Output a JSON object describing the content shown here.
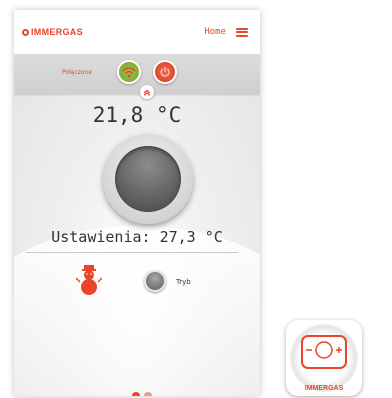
{
  "header": {
    "brand": "IMMERGAS",
    "home_label": "Home"
  },
  "status": {
    "connection_label": "Połączone"
  },
  "thermostat": {
    "current_temp": "21,8 °C",
    "settings_label": "Ustawienia: 27,3 °C",
    "mode_label": "Tryb"
  },
  "pager": {
    "current_page": 1,
    "total_pages": 2
  },
  "app_icon": {
    "brand": "IMMERGAS"
  },
  "colors": {
    "accent": "#e8452b",
    "wifi_green": "#8ab83e",
    "power_red": "#e3523a"
  },
  "icons": [
    "menu-icon",
    "wifi-icon",
    "power-icon",
    "chevron-up-icon",
    "snowman-icon",
    "thermostat-app-icon"
  ]
}
